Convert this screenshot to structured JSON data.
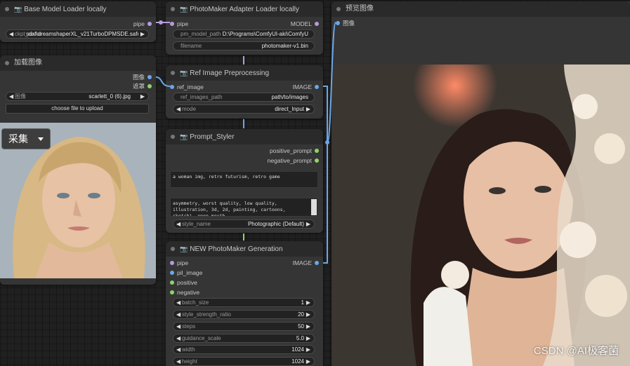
{
  "colors": {
    "accent_link": "#7b9bd8",
    "slot_pipe": "#b79bdc",
    "slot_image": "#6aa7e8",
    "slot_cond": "#8fd46a"
  },
  "base_loader": {
    "title": "Base Model Loader locally",
    "out_pipe": "pipe",
    "ckpt_label": "ckpt_name",
    "ckpt_value": "sdxl\\dreamshaperXL_v21TurboDPMSDE.safetensors"
  },
  "load_image": {
    "title": "加载图像",
    "out_image": "图像",
    "out_mask": "遮罩",
    "image_label": "图像",
    "image_value": "scarlett_0 (6).jpg",
    "upload_label": "choose file to upload",
    "caiji_label": "采集"
  },
  "adapter": {
    "title": "PhotoMaker Adapter Loader locally",
    "in_pipe": "pipe",
    "out_model": "MODEL",
    "path_label": "pm_model_path",
    "path_value": "D:\\Programs\\ComfyUI-aki\\ComfyU",
    "filename_label": "filename",
    "filename_value": "photomaker-v1.bin"
  },
  "ref": {
    "title": "Ref Image Preprocessing",
    "in_ref": "ref_image",
    "out_image": "IMAGE",
    "path_label": "ref_images_path",
    "path_value": "path/to/images",
    "mode_label": "mode",
    "mode_value": "direct_Input"
  },
  "styler": {
    "title": "Prompt_Styler",
    "out_pos": "positive_prompt",
    "out_neg": "negative_prompt",
    "pos_text": "a woman img, retro futurism, retro game",
    "neg_text": "asymmetry, worst quality, low quality, illustration, 3d, 2d, painting, cartoons, sketch), open mouth",
    "style_label": "style_name",
    "style_value": "Photographic (Default)"
  },
  "gen": {
    "title": "NEW PhotoMaker Generation",
    "in_pipe": "pipe",
    "in_pil": "pil_image",
    "in_pos": "positive",
    "in_neg": "negative",
    "out_image": "IMAGE",
    "params": [
      {
        "label": "batch_size",
        "value": "1"
      },
      {
        "label": "style_strength_ratio",
        "value": "20"
      },
      {
        "label": "steps",
        "value": "50"
      },
      {
        "label": "guidance_scale",
        "value": "5.0"
      },
      {
        "label": "width",
        "value": "1024"
      },
      {
        "label": "height",
        "value": "1024"
      }
    ]
  },
  "preview": {
    "title": "预览图像",
    "in_image": "图像",
    "watermark": "CSDN @AI极客菌"
  }
}
